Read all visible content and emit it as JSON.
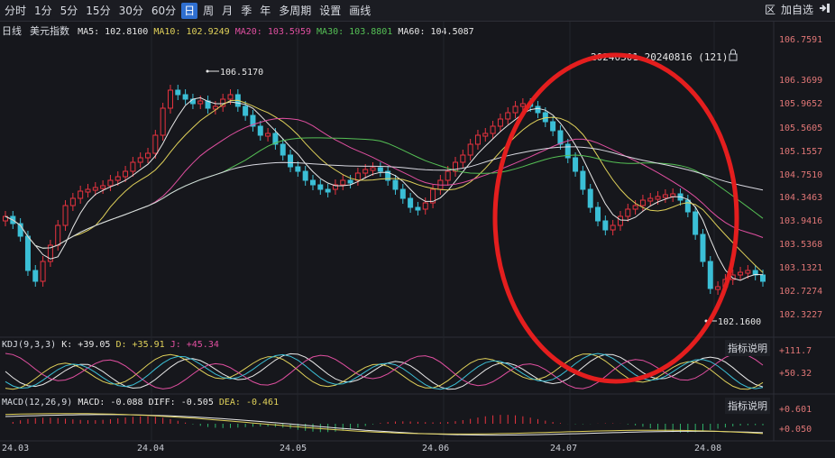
{
  "toolbar": {
    "periods": [
      "分时",
      "1分",
      "5分",
      "15分",
      "30分",
      "60分",
      "日",
      "周",
      "月",
      "季",
      "年",
      "多周期"
    ],
    "active_period": "日",
    "settings_label": "设置",
    "draw_label": "画线",
    "region_label": "区",
    "add_watch_label": "加自选",
    "exit_icon": "exit-icon"
  },
  "ma_legend": {
    "indicator": "日线",
    "name": "美元指数",
    "ma5": "MA5: 102.8100",
    "ma10": "MA10: 102.9249",
    "ma20": "MA20: 103.5959",
    "ma30": "MA30: 103.8801",
    "ma60": "MA60: 104.5087"
  },
  "range_label": "20240301-20240816 (121)",
  "high_marker": "106.5170",
  "low_marker": "102.1600",
  "price_axis": [
    "106.7591",
    "106.3699",
    "105.9652",
    "105.5605",
    "105.1557",
    "104.7510",
    "104.3463",
    "103.9416",
    "103.5368",
    "103.1321",
    "102.7274",
    "102.3227"
  ],
  "kdj": {
    "label": "KDJ(9,3,3)",
    "k": "K: +39.05",
    "d": "D: +35.91",
    "j": "J: +45.34",
    "axis": [
      "+111.7",
      "+50.32"
    ],
    "button": "指标说明"
  },
  "macd": {
    "label": "MACD(12,26,9)",
    "macd": "MACD: -0.088",
    "diff": "DIFF: -0.505",
    "dea": "DEA: -0.461",
    "axis": [
      "+0.601",
      "+0.050"
    ],
    "button": "指标说明"
  },
  "x_axis": [
    "24.03",
    "24.04",
    "24.05",
    "24.06",
    "24.07",
    "24.08"
  ],
  "colors": {
    "up": "#e8333f",
    "down": "#3bbfd6",
    "annotation": "#e41e1e",
    "background": "#16171c"
  }
}
